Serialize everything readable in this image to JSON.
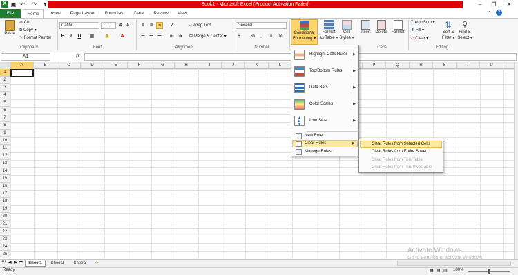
{
  "window": {
    "title": "Book1 - Microsoft Excel (Product Activation Failed)",
    "minimize": "–",
    "restore": "❐",
    "close": "✕",
    "help": "?"
  },
  "tabs": [
    "File",
    "Home",
    "Insert",
    "Page Layout",
    "Formulas",
    "Data",
    "Review",
    "View"
  ],
  "ribbon": {
    "clipboard": {
      "paste": "Paste",
      "cut": "Cut",
      "copy": "Copy ▾",
      "format_painter": "Format Painter",
      "label": "Clipboard"
    },
    "font": {
      "name": "Calibri",
      "size": "11",
      "label": "Font"
    },
    "alignment": {
      "wrap": "Wrap Text",
      "merge": "Merge & Center ▾",
      "label": "Alignment"
    },
    "number": {
      "format": "General",
      "label": "Number"
    },
    "styles": {
      "conditional": "Conditional",
      "conditional2": "Formatting ▾",
      "format_table": "Format",
      "format_table2": "as Table ▾",
      "cell_styles": "Cell",
      "cell_styles2": "Styles ▾",
      "label": "Styles"
    },
    "cells": {
      "insert": "Insert",
      "delete": "Delete",
      "format": "Format",
      "label": "Cells"
    },
    "editing": {
      "autosum": "AutoSum ▾",
      "fill": "Fill ▾",
      "clear": "Clear ▾",
      "sort": "Sort &",
      "sort2": "Filter ▾",
      "find": "Find &",
      "find2": "Select ▾",
      "label": "Editing"
    }
  },
  "formula_bar": {
    "namebox": "A1",
    "fx": "fx"
  },
  "columns": [
    "A",
    "B",
    "C",
    "D",
    "E",
    "F",
    "G",
    "H",
    "I",
    "J",
    "K",
    "L",
    "M",
    "N",
    "O",
    "P",
    "Q",
    "R",
    "S",
    "T",
    "U"
  ],
  "rows": [
    "1",
    "2",
    "3",
    "4",
    "5",
    "6",
    "7",
    "8",
    "9",
    "10",
    "11",
    "12",
    "13",
    "14",
    "15",
    "16",
    "17",
    "18",
    "19",
    "20",
    "21",
    "22",
    "23",
    "24",
    "25"
  ],
  "cf_menu": [
    "Highlight Cells Rules",
    "Top/Bottom Rules",
    "Data Bars",
    "Color Scales",
    "Icon Sets",
    "New Rule...",
    "Clear Rules",
    "Manage Rules..."
  ],
  "clear_submenu": [
    "Clear Rules from Selected Cells",
    "Clear Rules from Entire Sheet",
    "Clear Rules from This Table",
    "Clear Rules from This PivotTable"
  ],
  "sheets": [
    "Sheet1",
    "Sheet2",
    "Sheet3"
  ],
  "status": {
    "ready": "Ready",
    "zoom": "100%"
  },
  "watermark": {
    "line1": "Activate Windows",
    "line2": "Go to Settings to activate Windows."
  },
  "colors": {
    "title_red": "#e00000",
    "file_tab": "#1e7e34",
    "menu_highlight": "#fde9a0"
  }
}
